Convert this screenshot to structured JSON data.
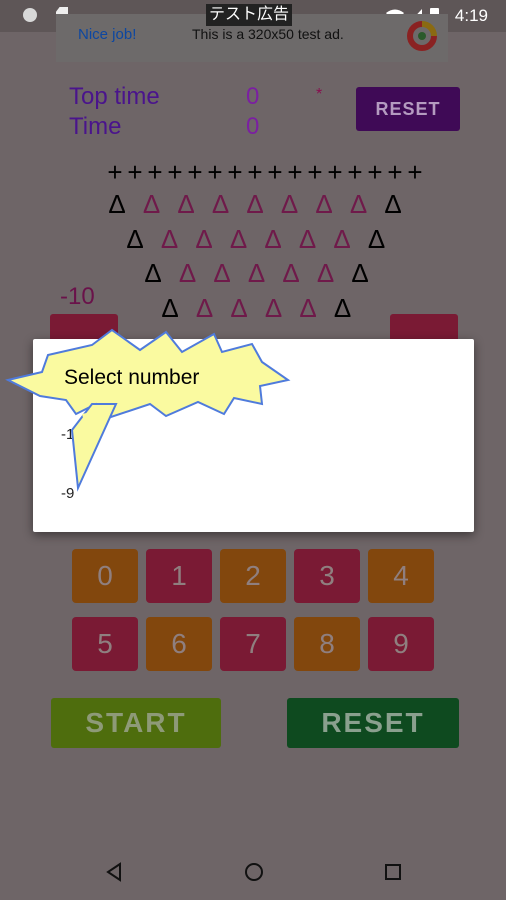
{
  "status_bar": {
    "time": "4:19"
  },
  "ad": {
    "tag": "テスト広告",
    "nice": "Nice job!",
    "test_text": "This is a 320x50 test ad."
  },
  "header": {
    "top_time_label": "Top time",
    "top_time_value": "0",
    "time_label": "Time",
    "time_value": "0",
    "star": "*",
    "reset_label": "RESET"
  },
  "board": {
    "rows": [
      [
        "+",
        "+",
        "+",
        "+",
        "+",
        "+",
        "+",
        "+",
        "+",
        "+",
        "+",
        "+",
        "+",
        "+",
        "+",
        "+"
      ],
      [
        "Δ",
        "Δ",
        "Δ",
        "Δ",
        "Δ",
        "Δ",
        "Δ",
        "Δ",
        "Δ"
      ],
      [
        "Δ",
        "Δ",
        "Δ",
        "Δ",
        "Δ",
        "Δ",
        "Δ",
        "Δ"
      ],
      [
        "Δ",
        "Δ",
        "Δ",
        "Δ",
        "Δ",
        "Δ",
        "Δ"
      ],
      [
        "Δ",
        "Δ",
        "Δ",
        "Δ",
        "Δ",
        "Δ"
      ]
    ],
    "selected_number": "-10"
  },
  "keypad": {
    "digits": [
      "0",
      "1",
      "2",
      "3",
      "4",
      "5",
      "6",
      "7",
      "8",
      "9"
    ]
  },
  "buttons": {
    "start": "START",
    "reset": "RESET"
  },
  "dialog": {
    "title": "Select number",
    "options": [
      "-10",
      "-9"
    ]
  },
  "colors": {
    "dim_overlay": "#6e6567",
    "dialog_bg": "#ffffff",
    "burst_fill": "#fafaa0",
    "burst_stroke": "#4f7bdc"
  }
}
